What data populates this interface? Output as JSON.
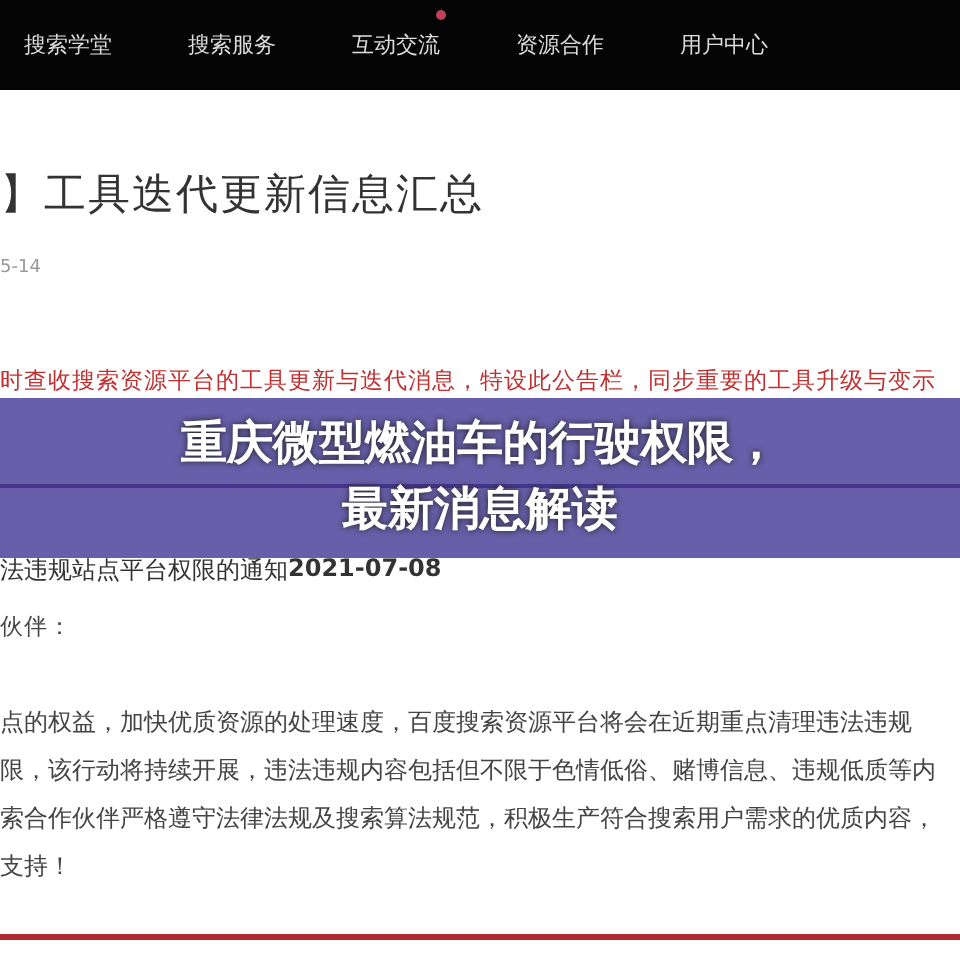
{
  "nav": {
    "items": [
      {
        "label": "搜索学堂",
        "dot": false
      },
      {
        "label": "搜索服务",
        "dot": false
      },
      {
        "label": "互动交流",
        "dot": true
      },
      {
        "label": "资源合作",
        "dot": false
      },
      {
        "label": "用户中心",
        "dot": false
      }
    ]
  },
  "article": {
    "title": "】工具迭代更新信息汇总",
    "date": "5-14",
    "intro": "时查收搜索资源平台的工具更新与迭代消息，特设此公告栏，同步重要的工具升级与变示",
    "notice_title": "法违规站点平台权限的通知",
    "notice_date": "2021-07-08",
    "greeting": "伙伴：",
    "paragraph_lines": [
      "点的权益，加快优质资源的处理速度，百度搜索资源平台将会在近期重点清理违法违规",
      "限，该行动将持续开展，违法违规内容包括但不限于色情低俗、赌博信息、违规低质等内",
      "索合作伙伴严格遵守法律法规及搜索算法规范，积极生产符合搜索用户需求的优质内容，",
      "支持！"
    ]
  },
  "banner": {
    "lines": [
      "重庆微型燃油车的行驶权限，",
      "最新消息解读"
    ]
  }
}
